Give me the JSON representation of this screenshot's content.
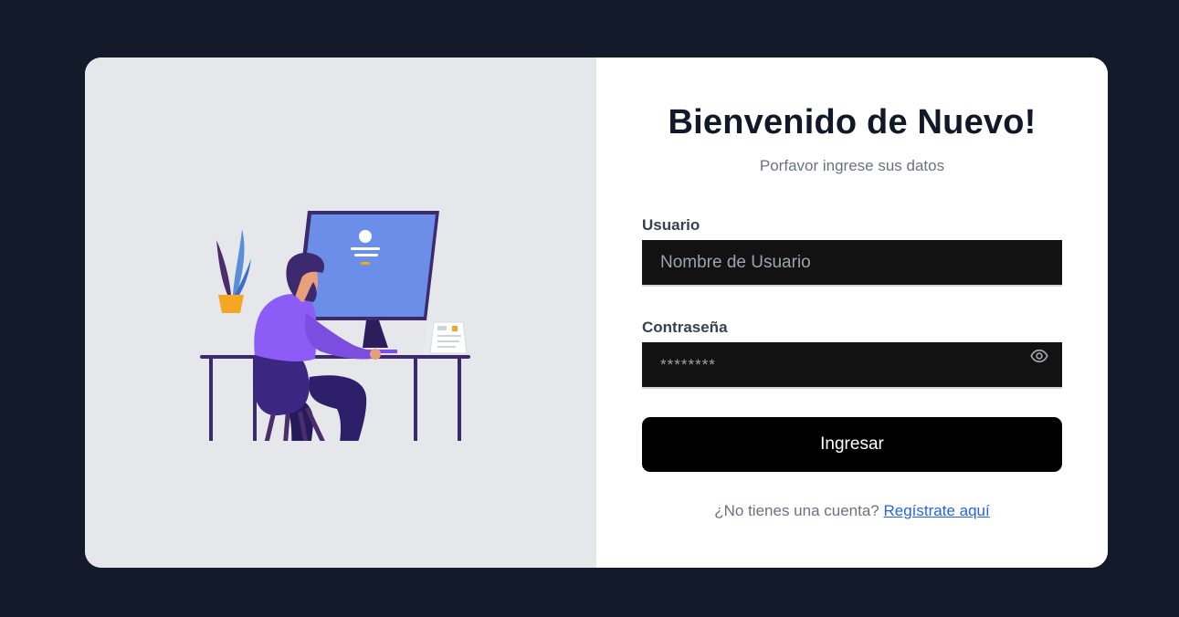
{
  "login": {
    "title": "Bienvenido de Nuevo!",
    "subtitle": "Porfavor ingrese sus datos",
    "username": {
      "label": "Usuario",
      "placeholder": "Nombre de Usuario",
      "value": ""
    },
    "password": {
      "label": "Contraseña",
      "value": "********"
    },
    "submit_label": "Ingresar",
    "register_prompt": "¿No tienes una cuenta?",
    "register_link": "Regístrate aquí"
  },
  "colors": {
    "page_background": "#131a29",
    "left_panel": "#e5e7eb",
    "input_background": "#121212",
    "button": "#000000",
    "link": "#2563eb"
  },
  "icons": {
    "password_toggle": "eye-icon",
    "illustration": "person-at-computer-illustration"
  }
}
